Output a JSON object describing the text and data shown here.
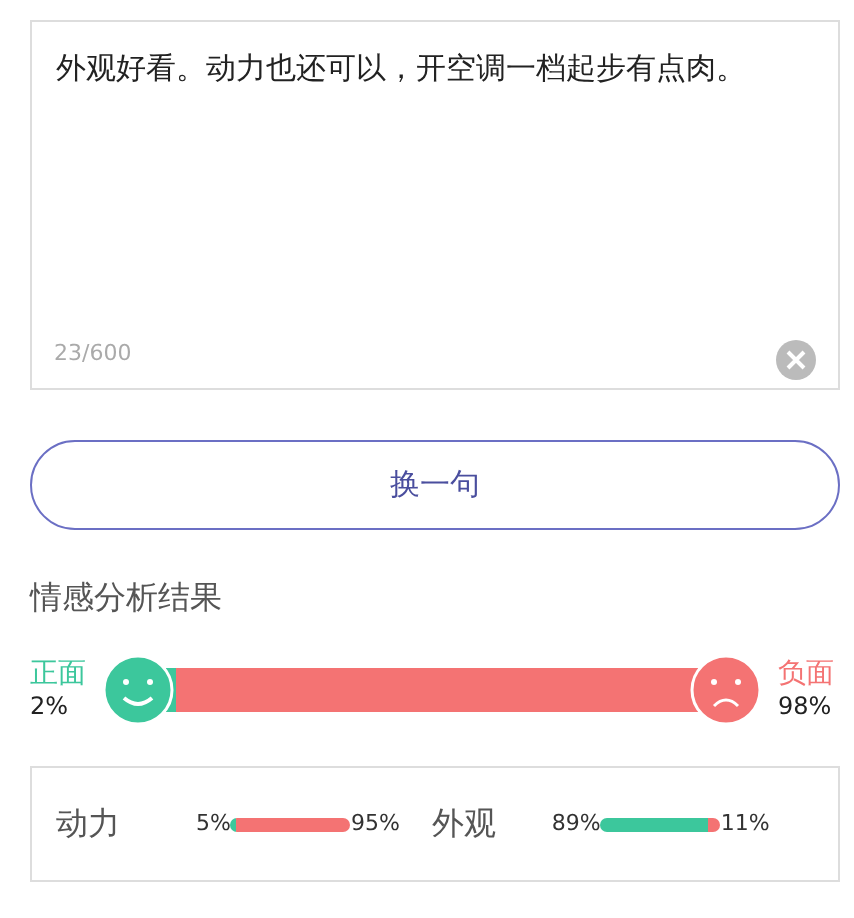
{
  "input": {
    "value": "外观好看。动力也还可以，开空调一档起步有点肉。",
    "counter": "23/600"
  },
  "button": {
    "label": "换一句"
  },
  "result": {
    "title": "情感分析结果",
    "positive_label": "正面",
    "positive_pct": "2%",
    "negative_label": "负面",
    "negative_pct": "98%",
    "level": 0.02
  },
  "aspects": [
    {
      "label": "动力",
      "positive_pct": "5%",
      "negative_pct": "95%",
      "level": 0.05
    },
    {
      "label": "外观",
      "positive_pct": "89%",
      "negative_pct": "11%",
      "level": 0.89
    }
  ]
}
